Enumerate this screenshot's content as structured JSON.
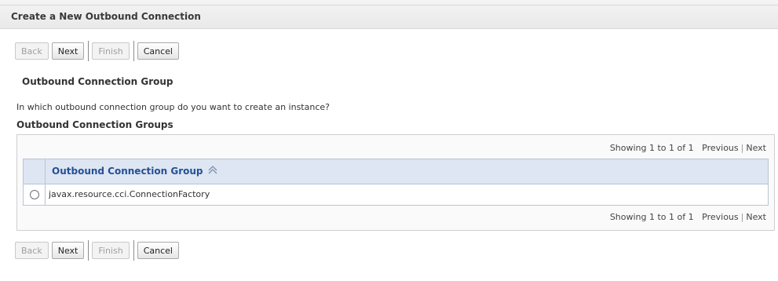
{
  "page": {
    "title": "Create a New Outbound Connection"
  },
  "toolbar": {
    "back_label": "Back",
    "next_label": "Next",
    "finish_label": "Finish",
    "cancel_label": "Cancel"
  },
  "section": {
    "title": "Outbound Connection Group",
    "prompt": "In which outbound connection group do you want to create an instance?"
  },
  "groups": {
    "title": "Outbound Connection Groups",
    "pager": {
      "showing": "Showing 1 to 1 of 1",
      "previous": "Previous",
      "next": "Next"
    },
    "table": {
      "column_header": "Outbound Connection Group",
      "sort_icon": "sort-ascending-icon",
      "rows": [
        {
          "value": "javax.resource.cci.ConnectionFactory",
          "selected": false
        }
      ]
    }
  }
}
